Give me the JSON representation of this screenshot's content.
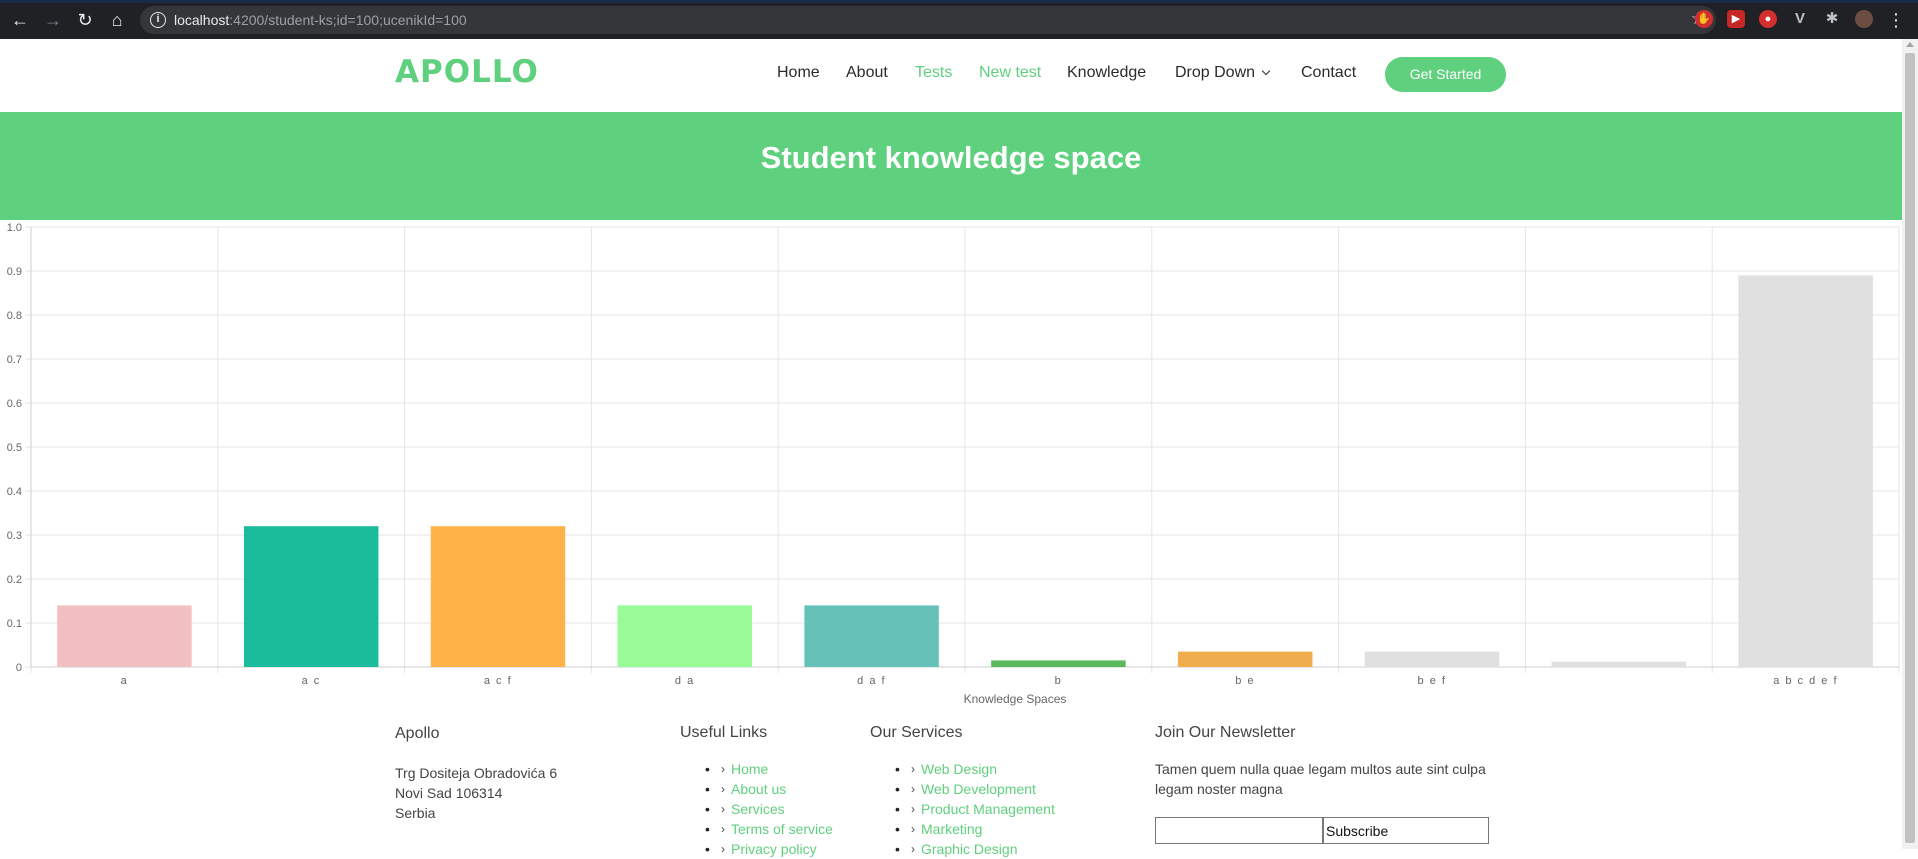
{
  "browser": {
    "url_host": "localhost",
    "url_path": ":4200/student-ks;id=100;ucenikId=100"
  },
  "header": {
    "logo": "APOLLO",
    "nav": [
      "Home",
      "About",
      "Tests",
      "New test",
      "Knowledge",
      "Drop Down",
      "Contact"
    ],
    "cta": "Get Started"
  },
  "hero": {
    "title": "Student knowledge space"
  },
  "chart_data": {
    "type": "bar",
    "categories": [
      "a",
      "a c",
      "a c f",
      "d a",
      "d a f",
      "b",
      "b e",
      "b e f",
      "",
      "a b c d e f"
    ],
    "values": [
      0.14,
      0.32,
      0.32,
      0.14,
      0.14,
      0.015,
      0.035,
      0.035,
      0.012,
      0.89
    ],
    "colors": [
      "#f2c0c0",
      "#1abc9c",
      "#ffb248",
      "#98fb98",
      "#66c2b8",
      "#5cb85c",
      "#f0ad4e",
      "#e0e0e0",
      "#e0e0e0",
      "#e0e0e0"
    ],
    "xlabel": "Knowledge Spaces",
    "ylabel": "",
    "ylim": [
      0,
      1.0
    ],
    "yticks": [
      "0",
      "0.1",
      "0.2",
      "0.3",
      "0.4",
      "0.5",
      "0.6",
      "0.7",
      "0.8",
      "0.9",
      "1.0"
    ],
    "grid": true
  },
  "footer": {
    "company": {
      "title": "Apollo",
      "address": [
        "Trg Dositeja Obradovića 6",
        "Novi Sad 106314",
        "Serbia"
      ]
    },
    "useful_links": {
      "title": "Useful Links",
      "items": [
        "Home",
        "About us",
        "Services",
        "Terms of service",
        "Privacy policy"
      ]
    },
    "services": {
      "title": "Our Services",
      "items": [
        "Web Design",
        "Web Development",
        "Product Management",
        "Marketing",
        "Graphic Design"
      ]
    },
    "newsletter": {
      "title": "Join Our Newsletter",
      "text": "Tamen quem nulla quae legam multos aute sint culpa legam noster magna",
      "button": "Subscribe"
    }
  }
}
